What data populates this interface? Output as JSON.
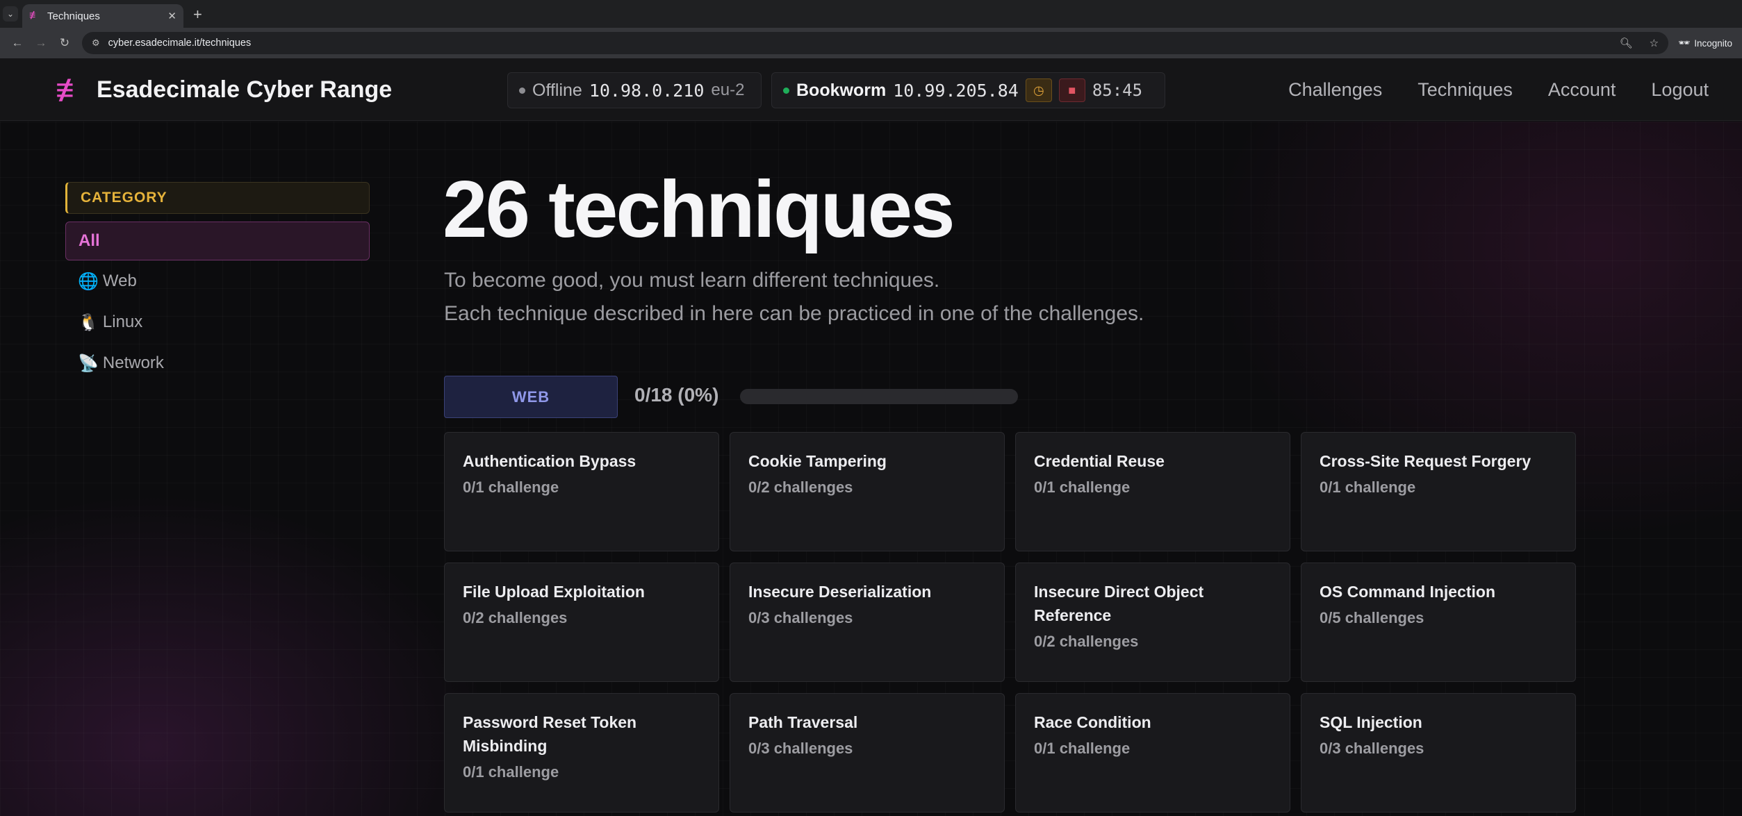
{
  "browser": {
    "tab_title": "Techniques",
    "tab_favicon": "≢",
    "url": "cyber.esadecimale.it/techniques",
    "incognito_label": "Incognito"
  },
  "header": {
    "logo_glyph": "≢",
    "site_title": "Esadecimale Cyber Range",
    "vpn": {
      "status": "Offline",
      "ip": "10.98.0.210",
      "region": "eu-2"
    },
    "machine": {
      "name": "Bookworm",
      "ip": "10.99.205.84",
      "timer": "85:45"
    },
    "nav": [
      "Challenges",
      "Techniques",
      "Account",
      "Logout"
    ]
  },
  "sidebar": {
    "header": "CATEGORY",
    "items": [
      {
        "emoji": "",
        "label": "All"
      },
      {
        "emoji": "🌐",
        "label": "Web"
      },
      {
        "emoji": "🐧",
        "label": "Linux"
      },
      {
        "emoji": "📡",
        "label": "Network"
      }
    ]
  },
  "main": {
    "title": "26 techniques",
    "subtitle_lines": [
      "To become good, you must learn different techniques.",
      "Each technique described in here can be practiced in one of the challenges."
    ],
    "section": {
      "tag": "WEB",
      "progress_text": "0/18 (0%)",
      "progress_fraction": 0
    },
    "cards": [
      {
        "title": "Authentication Bypass",
        "count": "0/1 challenge"
      },
      {
        "title": "Cookie Tampering",
        "count": "0/2 challenges"
      },
      {
        "title": "Credential Reuse",
        "count": "0/1 challenge"
      },
      {
        "title": "Cross-Site Request Forgery",
        "count": "0/1 challenge"
      },
      {
        "title": "File Upload Exploitation",
        "count": "0/2 challenges"
      },
      {
        "title": "Insecure Deserialization",
        "count": "0/3 challenges"
      },
      {
        "title": "Insecure Direct Object Reference",
        "count": "0/2 challenges"
      },
      {
        "title": "OS Command Injection",
        "count": "0/5 challenges"
      },
      {
        "title": "Password Reset Token Misbinding",
        "count": "0/1 challenge"
      },
      {
        "title": "Path Traversal",
        "count": "0/3 challenges"
      },
      {
        "title": "Race Condition",
        "count": "0/1 challenge"
      },
      {
        "title": "SQL Injection",
        "count": "0/3 challenges"
      }
    ]
  },
  "colors": {
    "accent_pink": "#e64cc7",
    "category_gold": "#e1b339",
    "web_indigo": "#8f97e8",
    "online_green": "#1fae5a"
  }
}
